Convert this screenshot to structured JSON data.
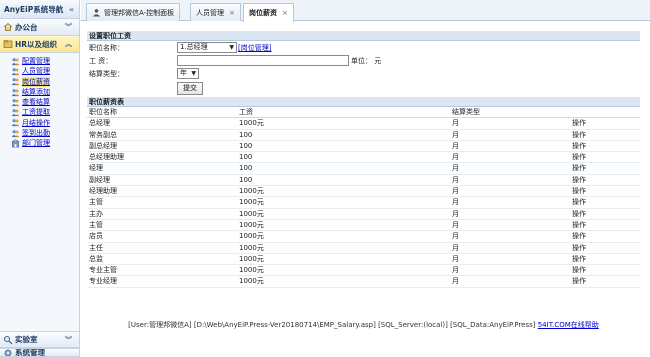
{
  "sidebar": {
    "title": "AnyEiP系统导航",
    "collapse_icon": "double-chevron-left-icon",
    "sections": [
      {
        "label": "办公台"
      },
      {
        "label": "HR以及组织"
      }
    ],
    "items": [
      {
        "label": "配置管理"
      },
      {
        "label": "人员管理"
      },
      {
        "label": "岗位薪资"
      },
      {
        "label": "结算添加"
      },
      {
        "label": "查看结算"
      },
      {
        "label": "工资提取"
      },
      {
        "label": "月结操作"
      },
      {
        "label": "签到出勤"
      },
      {
        "label": "部门管理"
      }
    ],
    "bottom_sections": [
      {
        "label": "实验室"
      },
      {
        "label": "系统管理"
      }
    ]
  },
  "tabs": [
    {
      "label": "管理邦微信A-控制面板"
    },
    {
      "label": "人员管理",
      "close": "×"
    },
    {
      "label": "岗位薪资",
      "close": "×"
    }
  ],
  "form": {
    "heading": "设置职位工资",
    "position_label": "职位名称：",
    "position_value": "1.总经理",
    "position_link": "[岗位管理]",
    "salary_label": "工  资：",
    "salary_value": "",
    "unit_label": "单位：  元",
    "settle_label": "结算类型：",
    "settle_value": "年",
    "submit_label": "提交"
  },
  "table": {
    "heading": "职位薪资表",
    "columns": [
      "职位名称",
      "工资",
      "结算类型",
      ""
    ],
    "rows": [
      [
        "总经理",
        "1000元",
        "月",
        "操作"
      ],
      [
        "常务副总",
        "100",
        "月",
        "操作"
      ],
      [
        "副总经理",
        "100",
        "月",
        "操作"
      ],
      [
        "总经理助理",
        "100",
        "月",
        "操作"
      ],
      [
        "经理",
        "100",
        "月",
        "操作"
      ],
      [
        "副经理",
        "100",
        "月",
        "操作"
      ],
      [
        "经理助理",
        "1000元",
        "月",
        "操作"
      ],
      [
        "主管",
        "1000元",
        "月",
        "操作"
      ],
      [
        "主办",
        "1000元",
        "月",
        "操作"
      ],
      [
        "主管",
        "1000元",
        "月",
        "操作"
      ],
      [
        "店员",
        "1000元",
        "月",
        "操作"
      ],
      [
        "主任",
        "1000元",
        "月",
        "操作"
      ],
      [
        "总监",
        "1000元",
        "月",
        "操作"
      ],
      [
        "专业主管",
        "1000元",
        "月",
        "操作"
      ],
      [
        "专业经理",
        "1000元",
        "月",
        "操作"
      ]
    ]
  },
  "status": {
    "text": "[User:管理邦微信A] [D:\\Web\\AnyEiP.Press-Ver20180714\\EMP_Salary.asp] [SQL_Server:(local)] [SQL_Data:AnyEiP.Press]",
    "link": "54IT.COM在线帮助"
  },
  "colors": {
    "accent": "#1f3c63",
    "link": "#0000cc",
    "highlight": "#f6e58c"
  }
}
